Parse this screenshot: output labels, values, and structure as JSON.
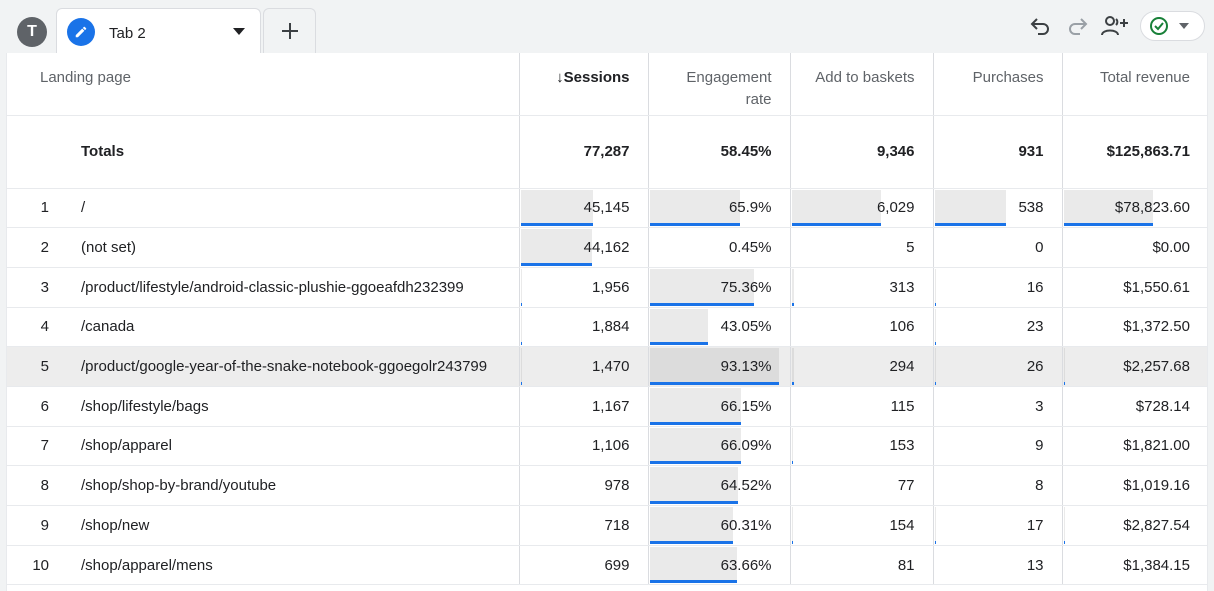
{
  "toolbar": {
    "avatar_letter": "T",
    "tab_label": "Tab 2"
  },
  "columns": {
    "landing_page": "Landing page",
    "sessions": "Sessions",
    "engagement_rate": "Engagement rate",
    "add_to_baskets": "Add to baskets",
    "purchases": "Purchases",
    "total_revenue": "Total revenue"
  },
  "totals": {
    "label": "Totals",
    "sessions": "77,287",
    "engagement_rate": "58.45%",
    "add_to_baskets": "9,346",
    "purchases": "931",
    "total_revenue": "$125,863.71"
  },
  "rows": [
    {
      "idx": "1",
      "page": "/",
      "sessions": "45,145",
      "engagement_rate": "65.9%",
      "add_to_baskets": "6,029",
      "purchases": "538",
      "total_revenue": "$78,823.60",
      "frac": [
        0.584,
        0.659,
        0.645,
        0.578,
        0.626
      ]
    },
    {
      "idx": "2",
      "page": "(not set)",
      "sessions": "44,162",
      "engagement_rate": "0.45%",
      "add_to_baskets": "5",
      "purchases": "0",
      "total_revenue": "$0.00",
      "frac": [
        0.571,
        0.0045,
        0.0005,
        0,
        0
      ]
    },
    {
      "idx": "3",
      "page": "/product/lifestyle/android-classic-plushie-ggoeafdh232399",
      "sessions": "1,956",
      "engagement_rate": "75.36%",
      "add_to_baskets": "313",
      "purchases": "16",
      "total_revenue": "$1,550.61",
      "frac": [
        0.025,
        0.7536,
        0.033,
        0.017,
        0.012
      ]
    },
    {
      "idx": "4",
      "page": "/canada",
      "sessions": "1,884",
      "engagement_rate": "43.05%",
      "add_to_baskets": "106",
      "purchases": "23",
      "total_revenue": "$1,372.50",
      "frac": [
        0.024,
        0.4305,
        0.011,
        0.025,
        0.011
      ]
    },
    {
      "idx": "5",
      "page": "/product/google-year-of-the-snake-notebook-ggoegolr243799",
      "sessions": "1,470",
      "engagement_rate": "93.13%",
      "add_to_baskets": "294",
      "purchases": "26",
      "total_revenue": "$2,257.68",
      "frac": [
        0.019,
        0.9313,
        0.031,
        0.028,
        0.018
      ],
      "highlight": true
    },
    {
      "idx": "6",
      "page": "/shop/lifestyle/bags",
      "sessions": "1,167",
      "engagement_rate": "66.15%",
      "add_to_baskets": "115",
      "purchases": "3",
      "total_revenue": "$728.14",
      "frac": [
        0.015,
        0.6615,
        0.012,
        0.003,
        0.006
      ]
    },
    {
      "idx": "7",
      "page": "/shop/apparel",
      "sessions": "1,106",
      "engagement_rate": "66.09%",
      "add_to_baskets": "153",
      "purchases": "9",
      "total_revenue": "$1,821.00",
      "frac": [
        0.014,
        0.6609,
        0.016,
        0.01,
        0.014
      ]
    },
    {
      "idx": "8",
      "page": "/shop/shop-by-brand/youtube",
      "sessions": "978",
      "engagement_rate": "64.52%",
      "add_to_baskets": "77",
      "purchases": "8",
      "total_revenue": "$1,019.16",
      "frac": [
        0.013,
        0.6452,
        0.008,
        0.009,
        0.008
      ]
    },
    {
      "idx": "9",
      "page": "/shop/new",
      "sessions": "718",
      "engagement_rate": "60.31%",
      "add_to_baskets": "154",
      "purchases": "17",
      "total_revenue": "$2,827.54",
      "frac": [
        0.009,
        0.6031,
        0.016,
        0.018,
        0.022
      ]
    },
    {
      "idx": "10",
      "page": "/shop/apparel/mens",
      "sessions": "699",
      "engagement_rate": "63.66%",
      "add_to_baskets": "81",
      "purchases": "13",
      "total_revenue": "$1,384.15",
      "frac": [
        0.009,
        0.6366,
        0.009,
        0.014,
        0.011
      ]
    }
  ],
  "colors": {
    "accent": "#1a73e8",
    "bar_fill": "#eaeaea",
    "status_ok": "#188038"
  },
  "icons": [
    "pencil-icon",
    "chevron-down-icon",
    "plus-icon",
    "undo-icon",
    "redo-icon",
    "share-user-icon",
    "check-circle-icon",
    "sort-arrow-down-icon"
  ]
}
